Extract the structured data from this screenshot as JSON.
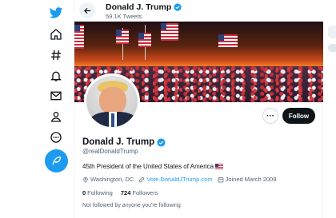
{
  "header": {
    "name": "Donald J. Trump",
    "tweet_count": "59.1K Tweets"
  },
  "profile": {
    "name": "Donald J. Trump",
    "handle": "@realDonaldTrump",
    "bio": "45th President of the United States of America",
    "location": "Washington, DC",
    "website": "Vote.DonaldJTrump.com",
    "joined": "Joined March 2009",
    "following_count": "0",
    "following_label": "Following",
    "followers_count": "724",
    "followers_label": "Followers",
    "not_followed_note": "Not followed by anyone you're following"
  },
  "actions": {
    "more_label": "···",
    "follow_label": "Follow"
  },
  "nav": {
    "items": [
      "twitter-logo",
      "home-icon",
      "explore-icon",
      "notifications-icon",
      "messages-icon",
      "profile-icon",
      "more-icon",
      "compose-icon"
    ]
  },
  "colors": {
    "accent": "#1d9bf0",
    "text": "#0f1419",
    "secondary": "#536471"
  }
}
